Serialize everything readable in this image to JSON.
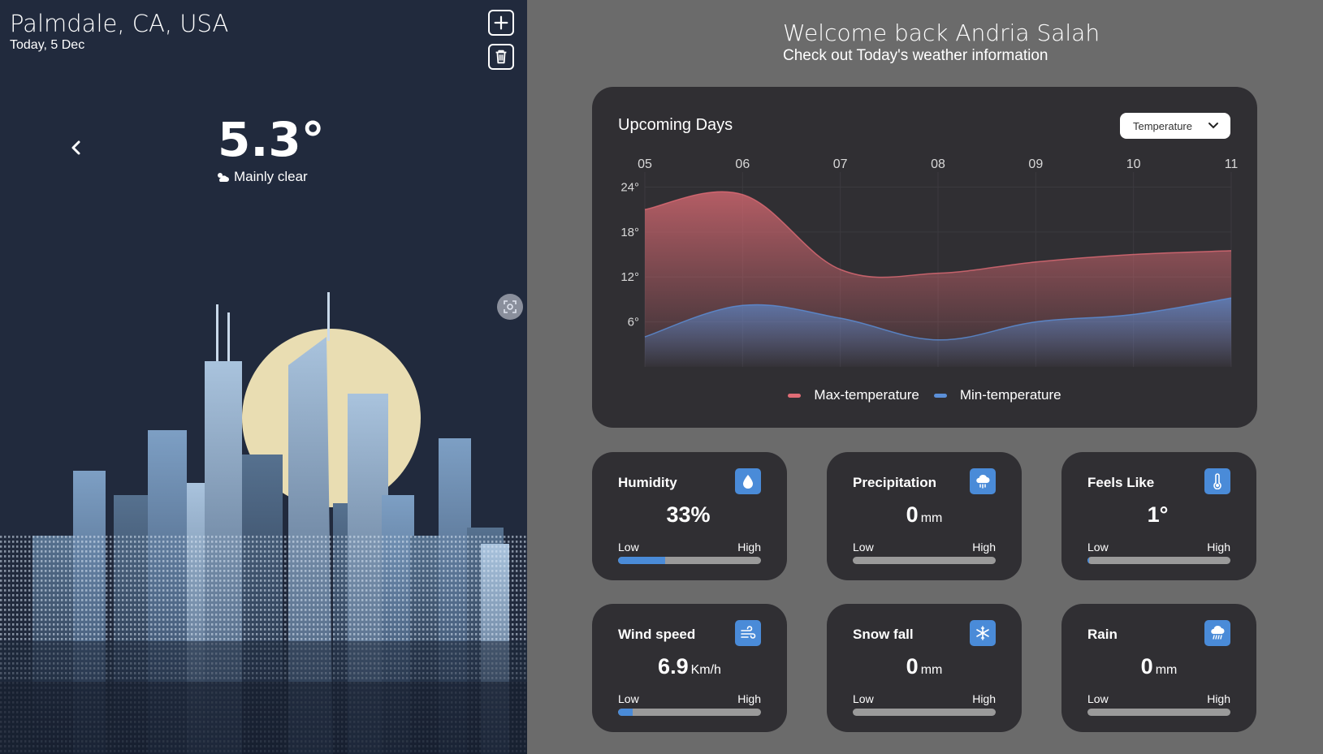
{
  "location": "Palmdale, CA, USA",
  "date": "Today, 5 Dec",
  "current": {
    "temperature": "5.3°",
    "condition": "Mainly clear"
  },
  "header": {
    "welcome": "Welcome back Andria Salah",
    "subtitle": "Check out Today's weather information"
  },
  "chart_card": {
    "title": "Upcoming Days",
    "select_value": "Temperature"
  },
  "chart_data": {
    "type": "area",
    "x": [
      "05",
      "06",
      "07",
      "08",
      "09",
      "10",
      "11"
    ],
    "y_ticks": [
      "24°",
      "18°",
      "12°",
      "6°"
    ],
    "ylim": [
      0,
      26
    ],
    "series": [
      {
        "name": "Max-temperature",
        "color": "#e06c75",
        "values": [
          21.0,
          23.0,
          13.0,
          12.5,
          14.0,
          15.0,
          15.5
        ]
      },
      {
        "name": "Min-temperature",
        "color": "#5b8fd8",
        "values": [
          4.0,
          8.2,
          6.5,
          3.6,
          6.0,
          7.0,
          9.2
        ]
      }
    ]
  },
  "cards": [
    {
      "title": "Humidity",
      "icon": "droplet-icon",
      "value": "33%",
      "unit": "",
      "level": 0.33,
      "low": "Low",
      "high": "High"
    },
    {
      "title": "Precipitation",
      "icon": "rain-cloud-icon",
      "value": "0",
      "unit": "mm",
      "level": 0,
      "low": "Low",
      "high": "High"
    },
    {
      "title": "Feels Like",
      "icon": "thermometer-icon",
      "value": "1°",
      "unit": "",
      "level": 0.01,
      "low": "Low",
      "high": "High"
    },
    {
      "title": "Wind speed",
      "icon": "wind-icon",
      "value": "6.9",
      "unit": "Km/h",
      "level": 0.1,
      "low": "Low",
      "high": "High"
    },
    {
      "title": "Snow fall",
      "icon": "snowflake-icon",
      "value": "0",
      "unit": "mm",
      "level": 0,
      "low": "Low",
      "high": "High"
    },
    {
      "title": "Rain",
      "icon": "rain-icon",
      "value": "0",
      "unit": "mm",
      "level": 0,
      "low": "Low",
      "high": "High"
    }
  ],
  "colors": {
    "accent": "#4a8bd8",
    "left_bg": "#212a3d",
    "right_bg": "#6b6b6b",
    "card_bg": "#302f33"
  }
}
